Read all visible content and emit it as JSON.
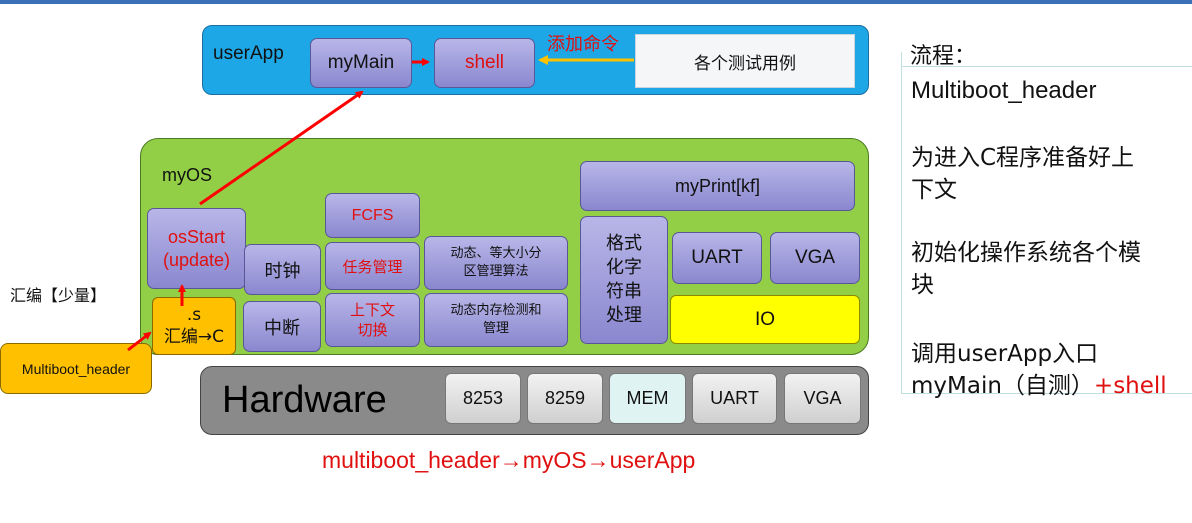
{
  "userapp": {
    "label": "userApp",
    "mymain": "myMain",
    "shell": "shell",
    "add_command": "添加命令",
    "test_cases": "各个测试用例"
  },
  "myos": {
    "label": "myOS",
    "osstart": "osStart\n(update)",
    "s_file": ".s\n汇编→C",
    "clock": "时钟",
    "interrupt": "中断",
    "fcfs": "FCFS",
    "task_mgmt": "任务管理",
    "context_switch": "上下文\n切换",
    "mem_algo": "动态、等大小分\n区管理算法",
    "mem_check": "动态内存检测和\n管理",
    "format_string": "格式\n化字\n符串\n处理",
    "myprint": "myPrint[kf]",
    "uart": "UART",
    "vga": "VGA",
    "io": "IO"
  },
  "asm_label": "汇编【少量】",
  "multiboot_box": "Multiboot_header",
  "hardware": {
    "label": "Hardware",
    "items": [
      "8253",
      "8259",
      "MEM",
      "UART",
      "VGA"
    ]
  },
  "flow_caption": "multiboot_header→myOS→userApp",
  "process_panel": {
    "title": "流程：",
    "step1": "Multiboot_header",
    "step2": "为进入C程序准备好上\n下文",
    "step3": "初始化操作系统各个模\n块",
    "step4_line1": "调用userApp入口",
    "step4_main": "myMain（自测）",
    "step4_plus": "+shell"
  },
  "colors": {
    "userapp_bg": "#1ea7e6",
    "myos_bg": "#92cf46",
    "io_bg": "#ffff00",
    "asm_bg": "#ffc000",
    "hardware_bg": "#8a8a8a",
    "arrow_red": "#ff0000",
    "arrow_orange": "#ffc000"
  }
}
